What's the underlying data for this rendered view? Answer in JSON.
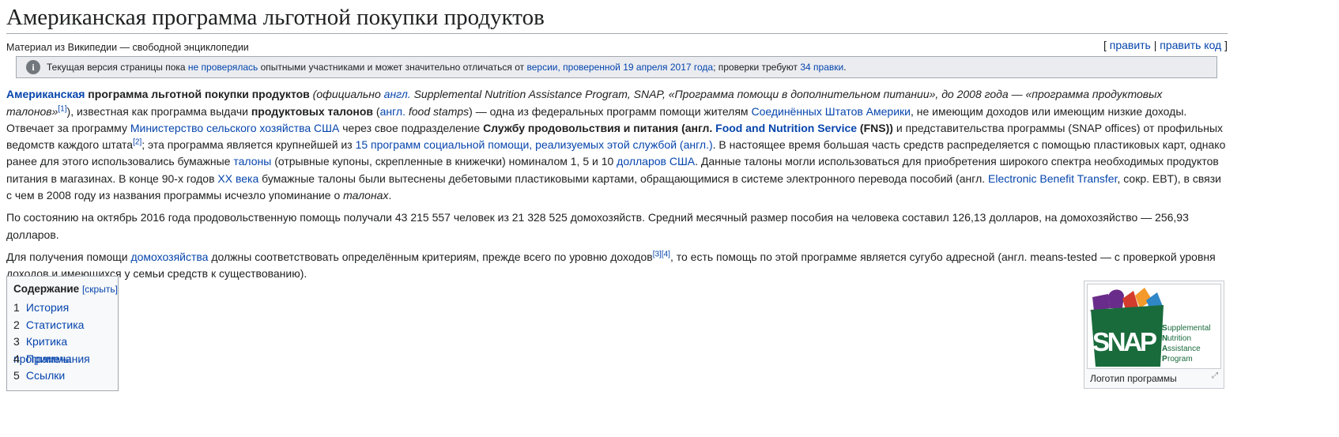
{
  "title": "Американская программа льготной покупки продуктов",
  "site_sub": "Материал из Википедии — свободной энциклопедии",
  "edit": {
    "open": "[ ",
    "edit": "править",
    "sep": " | ",
    "edit_code": "править код",
    "close": " ]"
  },
  "notice": {
    "icon": "i",
    "t1": "Текущая версия страницы пока ",
    "l1": "не проверялась",
    "t2": " опытными участниками и может значительно отличаться от ",
    "l2": "версии, проверенной 19 апреля 2017 года",
    "t3": "; проверки требуют ",
    "l3": "34 правки",
    "t4": "."
  },
  "p1": {
    "a1": "Американская",
    "b1": " программа льготной покупки продуктов",
    "i1": " (официально ",
    "l_angl": "англ.",
    "i2": " Supplemental Nutrition Assistance Program, SNAP, «Программа помощи в дополнительном питании», до 2008 года — «программа продуктовых талонов»",
    "ref1": "[1]",
    "t1": "), известная как программа выдачи ",
    "b2": "продуктовых талонов",
    "t2": " (",
    "l_angl2": "англ.",
    "i3": " food stamps",
    "t3": ") — одна из федеральных программ помощи жителям ",
    "l_usa": "Соединённых Штатов Америки",
    "t4": ", не имеющим доходов или имеющим низкие доходы. Отвечает за программу ",
    "l_usda": "Министерство сельского хозяйства США",
    "t5": " через свое подразделение ",
    "b3": "Службу продовольствия и питания (англ. ",
    "l_fns": "Food and Nutrition Service",
    "b4": " (FNS))",
    "t6": " и представительства программы (SNAP offices) от профильных ведомств каждого штата",
    "ref2": "[2]",
    "t7": "; эта программа является крупнейшей из ",
    "l_15": "15 программ социальной помощи, реализуемых этой службой (англ.)",
    "t8": ". В настоящее время большая часть средств распределяется с помощью пластиковых карт, однако ранее для этого использовались бумажные ",
    "l_tal": "талоны",
    "t9": " (отрывные купоны, скрепленные в книжечки) номиналом 1, 5 и 10 ",
    "l_usd": "долларов США",
    "t10": ". Данные талоны могли использоваться для приобретения широкого спектра необходимых продуктов питания в магазинах. В конце 90-х годов ",
    "l_xx": "XX века",
    "t11": " бумажные талоны были вытеснены дебетовыми пластиковыми картами, обращающимися в системе электронного перевода пособий (англ. ",
    "l_ebt": "Electronic Benefit Transfer",
    "t12": ", сокр. EBT), в связи с чем в 2008 году из названия программы исчезло упоминание о ",
    "i4": "талонах",
    "t13": "."
  },
  "p2": "По состоянию на октябрь 2016 года продовольственную помощь получали 43 215 557 человек из 21 328 525 домохозяйств. Средний месячный размер пособия на человека составил 126,13 долларов, на домохозяйство — 256,93 долларов.",
  "p3": {
    "t1": "Для получения помощи ",
    "l1": "домохозяйства",
    "t2": " должны соответствовать определённым критериям, прежде всего по уровню доходов",
    "ref": "[3][4]",
    "t3": ", то есть помощь по этой программе является сугубо адресной (англ. means-tested — с проверкой уровня доходов и имеющихся у семьи средств к существованию)."
  },
  "toc": {
    "title": "Содержание",
    "hide": "[скрыть]",
    "items": [
      {
        "num": "1",
        "label": "История"
      },
      {
        "num": "2",
        "label": "Статистика"
      },
      {
        "num": "3",
        "label": "Критика программы"
      },
      {
        "num": "4",
        "label": "Примечания"
      },
      {
        "num": "5",
        "label": "Ссылки"
      }
    ]
  },
  "logo": {
    "tm": "™",
    "word": "SNAP",
    "lines": [
      "upplemental",
      "utrition",
      "ssistance",
      "rogram"
    ],
    "initials": [
      "S",
      "N",
      "A",
      "P"
    ],
    "caption": "Логотип программы",
    "colors": {
      "green": "#1a6b3c",
      "purple": "#6a2c8a",
      "red": "#d33b2c",
      "orange": "#f39a2b",
      "blue": "#2f87c8"
    }
  }
}
